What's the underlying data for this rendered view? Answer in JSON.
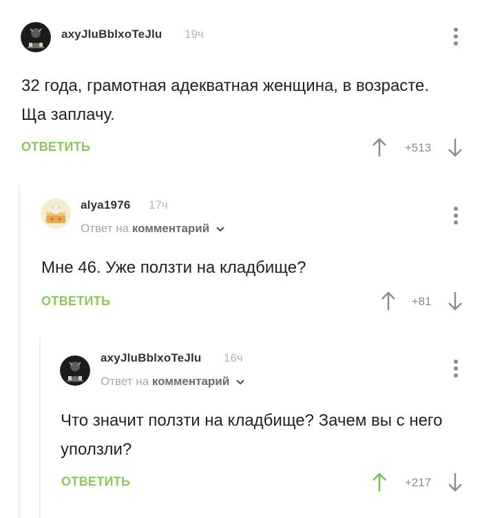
{
  "comments": [
    {
      "username": "axyJluBblxoTeJlu",
      "time": "19ч",
      "text": "32 года, грамотная адекватная женщина, в возрасте. Ща заплачу.",
      "reply_label": "ОТВЕТИТЬ",
      "rating": "+513",
      "upvoted": false
    },
    {
      "username": "alya1976",
      "time": "17ч",
      "reply_to_prefix": "Ответ на",
      "reply_to_target": "комментарий",
      "text": "Мне 46. Уже ползти на кладбище?",
      "reply_label": "ОТВЕТИТЬ",
      "rating": "+81",
      "upvoted": false
    },
    {
      "username": "axyJluBblxoTeJlu",
      "time": "16ч",
      "reply_to_prefix": "Ответ на",
      "reply_to_target": "комментарий",
      "text": "Что значит ползти на кладбище? Зачем вы с него уползли?",
      "reply_label": "ОТВЕТИТЬ",
      "rating": "+217",
      "upvoted": true
    }
  ],
  "colors": {
    "accent": "#8ac858",
    "upvote_active": "#6cc24a",
    "arrow_default": "#8c8c8c",
    "thread_line": "#ececec"
  },
  "icons": [
    "avatar-dark-figure",
    "avatar-cat-bed",
    "more-vertical-icon",
    "arrow-up-icon",
    "arrow-down-icon",
    "chevron-down-icon"
  ]
}
